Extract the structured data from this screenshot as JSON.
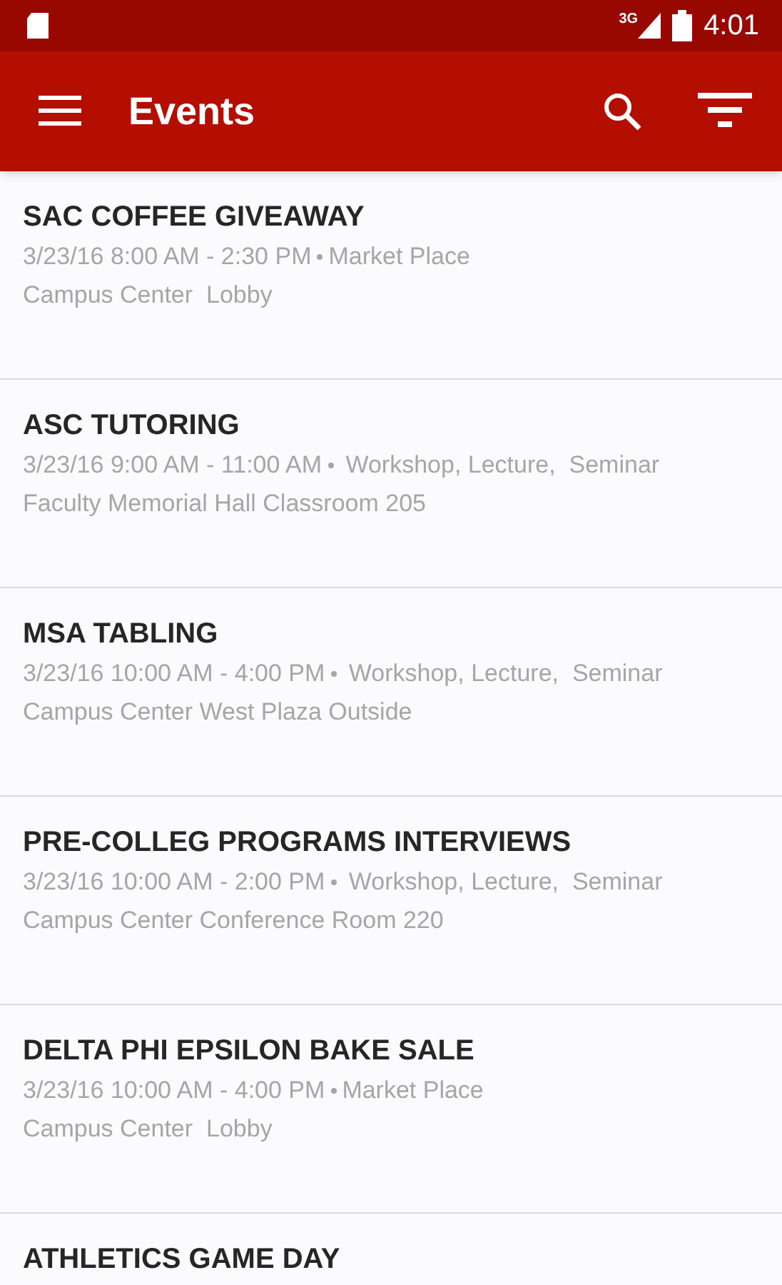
{
  "status_bar": {
    "network": "3G",
    "time": "4:01"
  },
  "app_bar": {
    "title": "Events"
  },
  "events": [
    {
      "title": "SAC COFFEE GIVEAWAY",
      "when": "3/23/16 8:00 AM - 2:30 PM",
      "category": "Market Place",
      "location": "Campus Center  Lobby"
    },
    {
      "title": "ASC TUTORING",
      "when": "3/23/16 9:00 AM - 11:00 AM",
      "category": " Workshop, Lecture,  Seminar",
      "location": "Faculty Memorial Hall Classroom 205"
    },
    {
      "title": "MSA TABLING",
      "when": "3/23/16 10:00 AM - 4:00 PM",
      "category": " Workshop, Lecture,  Seminar",
      "location": "Campus Center West Plaza Outside"
    },
    {
      "title": "PRE-COLLEG PROGRAMS INTERVIEWS",
      "when": "3/23/16 10:00 AM - 2:00 PM",
      "category": " Workshop, Lecture,  Seminar",
      "location": "Campus Center Conference Room 220"
    },
    {
      "title": "DELTA PHI EPSILON BAKE SALE",
      "when": "3/23/16 10:00 AM - 4:00 PM",
      "category": "Market Place",
      "location": "Campus Center  Lobby"
    },
    {
      "title": "ATHLETICS GAME DAY"
    }
  ]
}
